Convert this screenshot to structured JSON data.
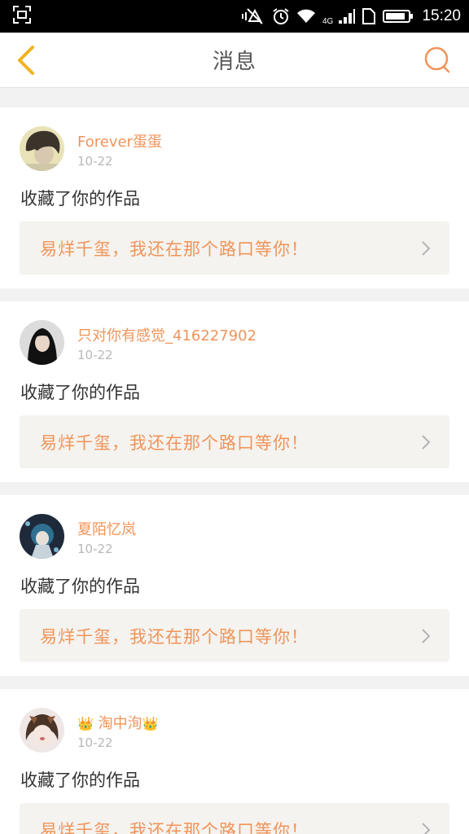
{
  "status_bar": {
    "time": "15:20",
    "network": "4G"
  },
  "header": {
    "title": "消息"
  },
  "messages": [
    {
      "user": "Forever蛋蛋",
      "date": "10-22",
      "action": "收藏了你的作品",
      "work_title": "易烊千玺，我还在那个路口等你！"
    },
    {
      "user": "只对你有感觉_416227902",
      "date": "10-22",
      "action": "收藏了你的作品",
      "work_title": "易烊千玺，我还在那个路口等你！"
    },
    {
      "user": "夏陌忆岚",
      "date": "10-22",
      "action": "收藏了你的作品",
      "work_title": "易烊千玺，我还在那个路口等你！"
    },
    {
      "user": "淘中洵",
      "user_decoration": "👑",
      "date": "10-22",
      "action": "收藏了你的作品",
      "work_title": "易烊千玺，我还在那个路口等你！"
    }
  ],
  "colors": {
    "accent": "#f0945a",
    "back_icon": "#f3b21d",
    "status_bar_bg": "#000000"
  }
}
